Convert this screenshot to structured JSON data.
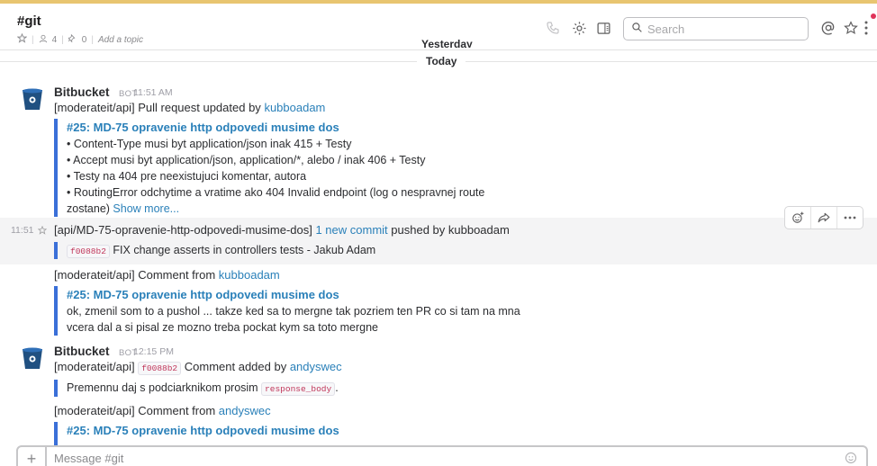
{
  "header": {
    "channel_name": "#git",
    "member_count": "4",
    "pinned_count": "0",
    "add_topic": "Add a topic",
    "search_placeholder": "Search"
  },
  "dividers": {
    "yesterday": "Yesterday",
    "today": "Today"
  },
  "messages": {
    "m1": {
      "sender": "Bitbucket",
      "bot": "BOT",
      "time": "11:51 AM",
      "text_prefix": "[moderateit/api] Pull request updated by ",
      "user": "kubboadam",
      "att_title": "#25: MD-75 opravenie http odpovedi musime dos",
      "att_lines": [
        "• Content-Type musi byt application/json inak 415 + Testy",
        "• Accept musi byt application/json, application/*, alebo / inak 406 + Testy",
        "• Testy na 404 pre neexistujuci komentar, autora",
        "• RoutingError odchytime a vratime ako 404 Invalid endpoint (log o nespravnej route"
      ],
      "att_last": "zostane) ",
      "show_more": "Show more..."
    },
    "m2": {
      "time": "11:51",
      "text_prefix": "[api/MD-75-opravenie-http-odpovedi-musime-dos] ",
      "commit_link": "1 new commit",
      "text_suffix": " pushed by kubboadam",
      "commit_hash": "f0088b2",
      "commit_msg": "FIX change asserts in controllers tests - Jakub Adam"
    },
    "m3": {
      "text_prefix": "[moderateit/api] Comment from ",
      "user": "kubboadam",
      "att_title": "#25: MD-75 opravenie http odpovedi musime dos",
      "att_lines": [
        "ok, zmenil som to a pushol ... takze ked sa to mergne tak pozriem ten PR co si tam na mna",
        "vcera dal a si pisal ze mozno treba pockat kym sa toto mergne"
      ]
    },
    "m4": {
      "sender": "Bitbucket",
      "bot": "BOT",
      "time": "12:15 PM",
      "text_prefix": "[moderateit/api] ",
      "commit_hash": "f0088b2",
      "text_mid": " Comment added by ",
      "user": "andyswec",
      "quote_text": "Premennu daj s podciarknikom prosim ",
      "quote_code": "response_body",
      "quote_end": "."
    },
    "m5": {
      "text_prefix": "[moderateit/api] Comment from ",
      "user": "andyswec",
      "att_title": "#25: MD-75 opravenie http odpovedi musime dos"
    }
  },
  "composer": {
    "placeholder": "Message #git"
  },
  "colors": {
    "accent_link": "#2a80b9",
    "attachment_bar": "#3a6fd8",
    "bitbucket_blue": "#205081",
    "top_strip": "#e8c570"
  },
  "icons": [
    "star-icon",
    "member-icon",
    "pin-icon",
    "phone-icon",
    "gear-icon",
    "details-icon",
    "search-icon",
    "mention-icon",
    "star-outline-icon",
    "more-vertical-icon",
    "add-reaction-icon",
    "share-icon",
    "more-horizontal-icon",
    "plus-icon",
    "emoji-icon"
  ]
}
